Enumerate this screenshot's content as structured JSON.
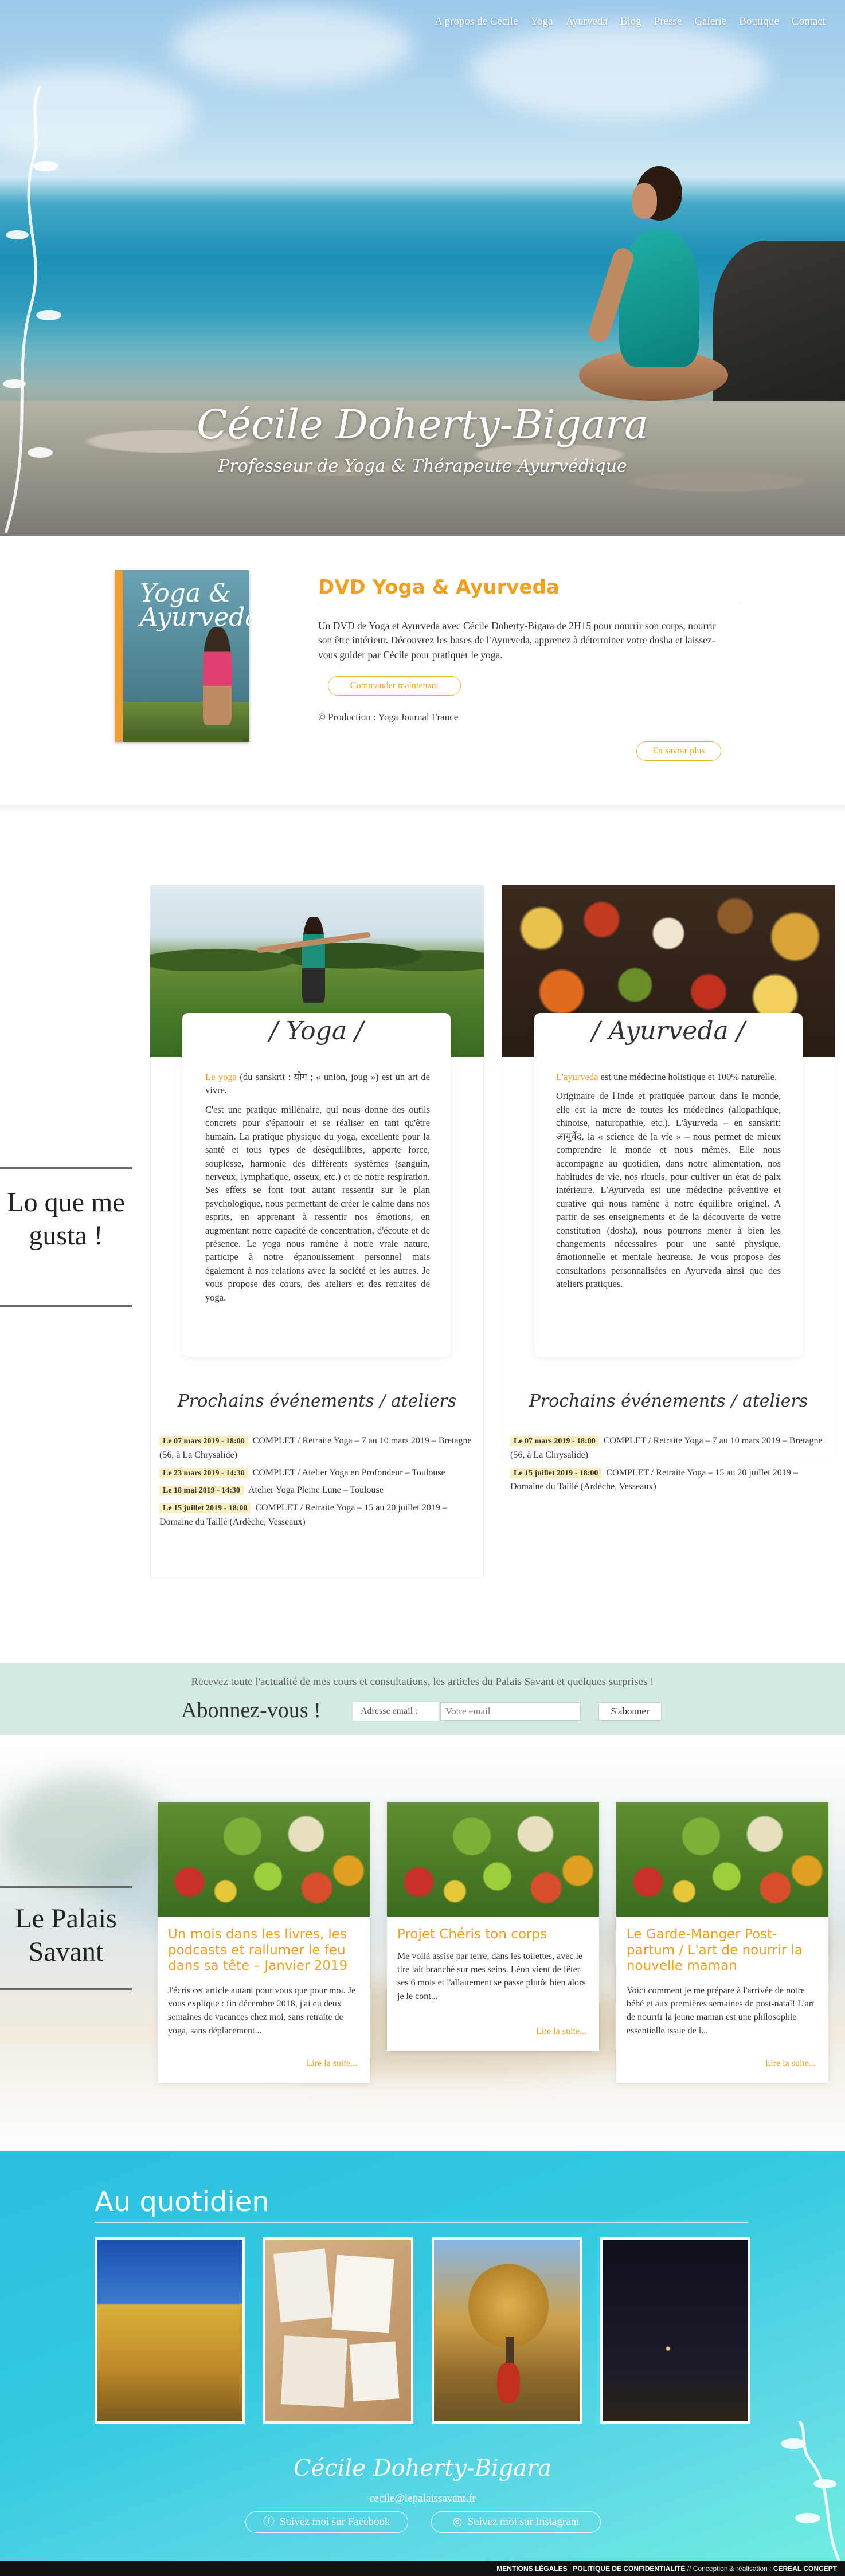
{
  "nav": {
    "items": [
      "A propos de Cécile",
      "Yoga",
      "Ayurveda",
      "Blog",
      "Presse",
      "Galerie",
      "Boutique",
      "Contact"
    ]
  },
  "hero": {
    "title": "Cécile Doherty-Bigara",
    "subtitle": "Professeur de Yoga & Thérapeute Ayurvédique"
  },
  "dvd": {
    "cover_text": "Yoga & Ayurveda",
    "title": "DVD Yoga & Ayurveda",
    "description": "Un DVD de Yoga et Ayurveda avec Cécile Doherty-Bigara de 2H15 pour nourrir son corps, nourrir son être intérieur. Découvrez les bases de l'Ayurveda, apprenez à déterminer votre dosha et laissez-vous guider par Cécile pour pratiquer le yoga.",
    "order_button": "Commander maintenant",
    "production": "© Production : Yoga Journal France",
    "more_button": "En savoir plus"
  },
  "lqmg": {
    "title": "Lo que me gusta !"
  },
  "yoga": {
    "title": "/ Yoga /",
    "intro_word": "Le yoga",
    "intro_rest": " (du sanskrit : योग ; « union, joug ») est un art de vivre.",
    "body": "C'est une pratique millénaire, qui nous donne des outils concrets pour s'épanouir et se réaliser en tant qu'être humain. La pratique physique du yoga, excellente pour la santé et tous types de déséquilibres, apporte force, souplesse, harmonie des différents systèmes (sanguin, nerveux, lymphatique, osseux, etc.) et de notre respiration. Ses effets se font tout autant ressentir sur le plan psychologique, nous permettant de créer le calme dans nos esprits, en apprenant à ressentir nos émotions, en augmentant notre capacité de concentration, d'écoute et de présence. Le yoga nous ramène à notre vraie nature, participe à notre épanouissement personnel mais également à nos relations avec la société et les autres. Je vous propose des cours, des ateliers et des retraites de yoga.",
    "events_title": "Prochains événements / ateliers",
    "events": [
      {
        "date": "Le 07 mars 2019 - 18:00",
        "text": "COMPLET / Retraite Yoga – 7 au 10 mars 2019 – Bretagne (56, à La Chrysalide)"
      },
      {
        "date": "Le 23 mars 2019 - 14:30",
        "text": "COMPLET / Atelier Yoga en Profondeur – Toulouse"
      },
      {
        "date": "Le 18 mai 2019 - 14:30",
        "text": "Atelier Yoga Pleine Lune – Toulouse"
      },
      {
        "date": "Le 15 juillet 2019 - 18:00",
        "text": "COMPLET / Retraite Yoga – 15 au 20 juillet 2019 – Domaine du Taillé (Ardèche, Vesseaux)"
      }
    ]
  },
  "ayurveda": {
    "title": "/ Ayurveda /",
    "intro_word": "L'ayurveda",
    "intro_rest": " est une médecine holistique et 100% naturelle.",
    "body": "Originaire de l'Inde et pratiquée partout dans le monde, elle est la mère de toutes les médecines (allopathique, chinoise, naturopathie, etc.). L'âyurveda – en sanskrit: आयुर्वेद, la « science de la vie » – nous permet de mieux comprendre le monde et nous mêmes. Elle nous accompagne au quotidien, dans notre alimentation, nos habitudes de vie, nos rituels, pour cultiver un état de paix intérieure. L'Ayurveda est une médecine préventive et curative qui nous ramène à notre équilibre originel. A partir de ses enseignements et de la découverte de votre constitution (dosha), nous pourrons mener à bien les changements nécessaires pour une santé physique, émotionnelle et mentale heureuse. Je vous propose des consultations personnalisées en Ayurveda ainsi que des ateliers pratiques.",
    "events_title": "Prochains événements / ateliers",
    "events": [
      {
        "date": "Le 07 mars 2019 - 18:00",
        "text": "COMPLET / Retraite Yoga – 7 au 10 mars 2019 – Bretagne (56, à La Chrysalide)"
      },
      {
        "date": "Le 15 juillet 2019 - 18:00",
        "text": "COMPLET / Retraite Yoga – 15 au 20 juillet 2019 – Domaine du Taillé (Ardèche, Vesseaux)"
      }
    ]
  },
  "newsletter": {
    "text": "Recevez toute l'actualité de mes cours et consultations, les articles du Palais Savant et quelques surprises !",
    "heading": "Abonnez-vous !",
    "label": "Adresse email :",
    "placeholder": "Votre email",
    "button": "S'abonner"
  },
  "palais": {
    "title": "Le Palais Savant",
    "posts": [
      {
        "title": "Un mois dans les livres, les podcasts et rallumer le feu dans sa tête – Janvier 2019",
        "excerpt": "J'écris cet article autant pour vous que pour moi. Je vous explique : fin décembre 2018, j'ai eu deux semaines de vacances chez moi, sans retraite de yoga, sans déplacement...",
        "more": "Lire la suite..."
      },
      {
        "title": "Projet Chéris ton corps",
        "excerpt": "Me voilà assise par terre, dans les toilettes, avec le tire lait branché sur mes seins. Léon vient de fêter ses 6 mois et l'allaitement se passe plutôt bien alors je le cont...",
        "more": "Lire la suite..."
      },
      {
        "title": "Le Garde-Manger Post-partum / L'art de nourrir la nouvelle maman",
        "excerpt": "Voici comment je me prépare à l'arrivée de notre bébé et aux premières semaines de post-natal! L'art de nourrir la jeune maman est une philosophie essentielle issue de l...",
        "more": "Lire la suite..."
      }
    ]
  },
  "quotidien": {
    "title": "Au quotidien",
    "signature": "Cécile Doherty-Bigara",
    "email": "cecile@lepalaissavant.fr",
    "facebook": "Suivez moi sur Facebook",
    "instagram": "Suivez moi sur Instagram"
  },
  "footer": {
    "legal": "MENTIONS LÉGALES",
    "privacy": "POLITIQUE DE CONFIDENTIALITÉ",
    "credit": "Conception & réalisation :",
    "agency": "CEREAL CONCEPT"
  },
  "colors": {
    "accent": "#f0a020",
    "newsletter_bg": "#d2e9e4",
    "quotidien_bg": "#32c9e0"
  }
}
